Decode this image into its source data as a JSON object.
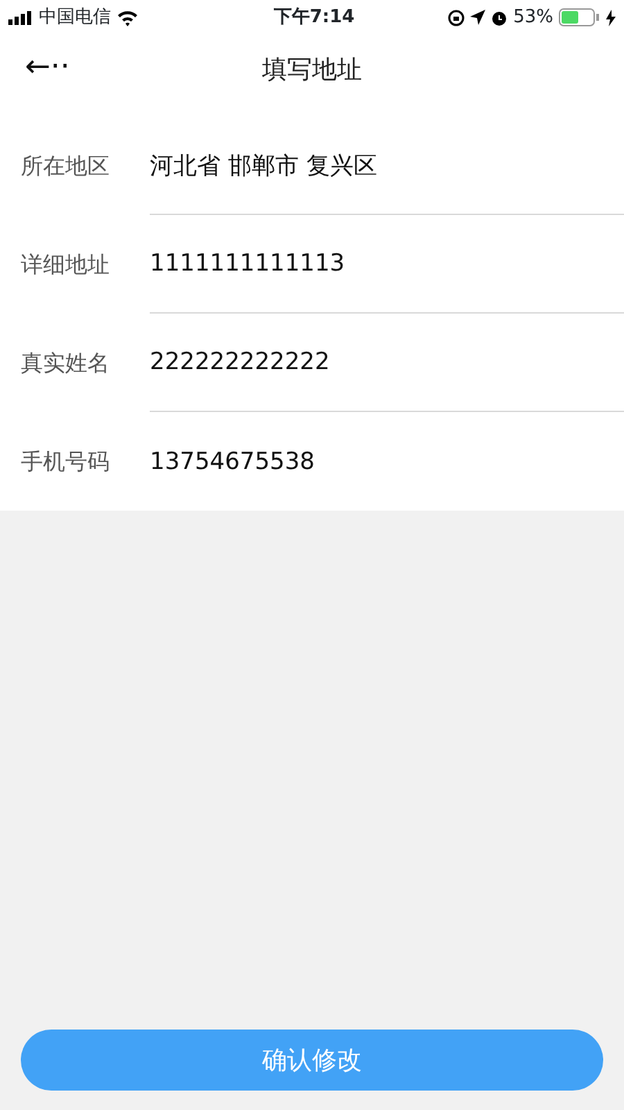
{
  "status_bar": {
    "carrier": "中国电信",
    "time": "下午7:14",
    "battery": "53%"
  },
  "header": {
    "back": "←··",
    "title": "填写地址"
  },
  "fields": [
    {
      "label": "所在地区",
      "value": "河北省 邯郸市 复兴区"
    },
    {
      "label": "详细地址",
      "value": "1111111111113"
    },
    {
      "label": "真实姓名",
      "value": "222222222222"
    },
    {
      "label": "手机号码",
      "value": "13754675538"
    }
  ],
  "submit": "确认修改"
}
